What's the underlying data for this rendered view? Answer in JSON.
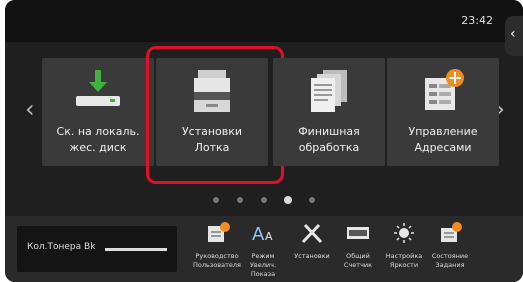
{
  "status": {
    "time": "23:42"
  },
  "side_tab_icon": "chevron-left",
  "tiles": [
    {
      "line1": "Ск. на локаль.",
      "line2": "жес. диск",
      "icon": "download-to-hdd"
    },
    {
      "line1": "Установки",
      "line2": "Лотка",
      "icon": "printer"
    },
    {
      "line1": "Финишная",
      "line2": "обработка",
      "icon": "document-stack"
    },
    {
      "line1": "Управление",
      "line2": "Адресами",
      "icon": "address-book-add"
    }
  ],
  "pager": {
    "count": 5,
    "active_index": 3
  },
  "toner": {
    "label": "Кол.Тонера Bk"
  },
  "bottom_items": [
    {
      "l1": "Руководство",
      "l2": "Пользователя",
      "l3": "",
      "icon": "manual"
    },
    {
      "l1": "Режим",
      "l2": "Увелич.",
      "l3": "Показа",
      "icon": "font-size"
    },
    {
      "l1": "Установки",
      "l2": "",
      "l3": "",
      "icon": "tools"
    },
    {
      "l1": "Общий",
      "l2": "Счетчик",
      "l3": "",
      "icon": "counter"
    },
    {
      "l1": "Настройка",
      "l2": "Яркости",
      "l3": "",
      "icon": "brightness"
    },
    {
      "l1": "Состояние",
      "l2": "Задания",
      "l3": "",
      "icon": "job-status"
    }
  ]
}
